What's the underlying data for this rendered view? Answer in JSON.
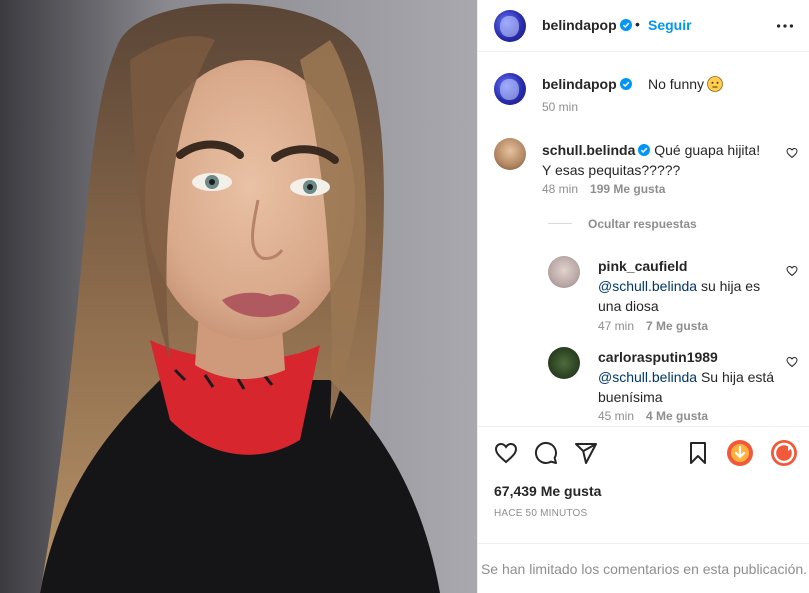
{
  "header": {
    "username": "belindapop",
    "separator": "•",
    "follow_label": "Seguir"
  },
  "caption": {
    "username": "belindapop",
    "text": "No funny",
    "emoji": "neutral-face-emoji",
    "time": "50 min"
  },
  "comments": [
    {
      "username": "schull.belinda",
      "text": "Qué guapa hijita! Y esas pequitas?????",
      "time": "48 min",
      "likes": "199 Me gusta"
    }
  ],
  "hide_replies_label": "Ocultar respuestas",
  "replies": [
    {
      "username": "pink_caufield",
      "mention": "@schull.belinda",
      "text": "su hija es una diosa",
      "time": "47 min",
      "likes": "7 Me gusta"
    },
    {
      "username": "carlorasputin1989",
      "mention": "@schull.belinda",
      "text": "Su hija está buenísima",
      "time": "45 min",
      "likes": "4 Me gusta"
    }
  ],
  "likes_count": "67,439 Me gusta",
  "post_time": "HACE 50 MINUTOS",
  "comments_limited": "Se han limitado los comentarios en esta publicación.",
  "colors": {
    "follow": "#0095f6",
    "secondary_text": "#8e8e8e",
    "verified": "#0095f6",
    "mention": "#00376b"
  },
  "icons": [
    "more-options-icon",
    "heart-icon",
    "comment-icon",
    "share-icon",
    "bookmark-icon",
    "verified-badge-icon"
  ]
}
